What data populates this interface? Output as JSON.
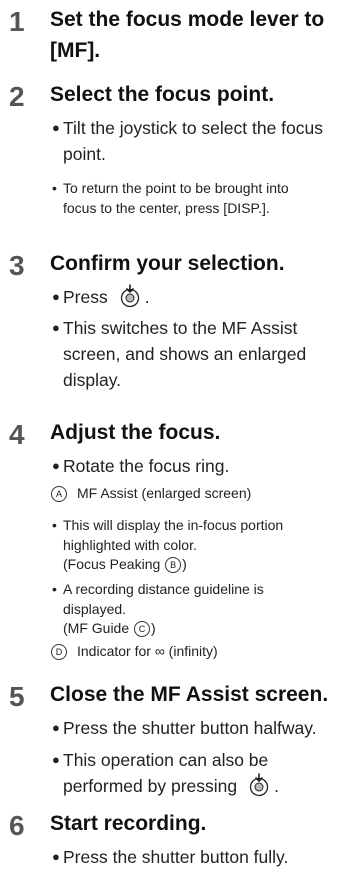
{
  "steps": [
    {
      "num": "1",
      "title_l1": "Set the focus mode lever to",
      "title_l2": "[MF]."
    },
    {
      "num": "2",
      "title": "Select the focus point.",
      "b1_l1": "Tilt the joystick to select the focus",
      "b1_l2": "point.",
      "n1_l1": "To return the point to be brought into",
      "n1_l2": "focus to the center, press [DISP.]."
    },
    {
      "num": "3",
      "title": "Confirm your selection.",
      "b1": "Press",
      "b1_end": ".",
      "b2_l1": "This switches to the MF Assist",
      "b2_l2": "screen, and shows an enlarged",
      "b2_l3": "display."
    },
    {
      "num": "4",
      "title": "Adjust the focus.",
      "b1": "Rotate the focus ring.",
      "refA_mark": "A",
      "refA": "MF Assist (enlarged screen)",
      "n1_l1": "This will display the in-focus portion",
      "n1_l2": "highlighted with color.",
      "n1_l3_a": "(Focus Peaking",
      "n1_l3_mark": "B",
      "n1_l3_b": ")",
      "n2_l1": "A recording distance guideline is",
      "n2_l2": "displayed.",
      "n2_l3_a": "(MF Guide",
      "n2_l3_mark": "C",
      "n2_l3_b": ")",
      "refD_mark": "D",
      "refD": "Indicator for ∞ (infinity)"
    },
    {
      "num": "5",
      "title": "Close the MF Assist screen.",
      "b1": "Press the shutter button halfway.",
      "b2_l1": "This operation can also be",
      "b2_l2": "performed by pressing",
      "b2_end": "."
    },
    {
      "num": "6",
      "title": "Start recording.",
      "b1": "Press the shutter button fully."
    }
  ],
  "icons": {
    "joystick": "joystick-press-icon"
  }
}
